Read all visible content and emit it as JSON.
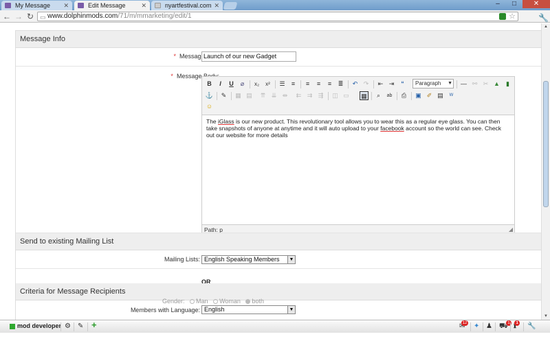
{
  "browser": {
    "tabs": [
      {
        "title": "My Message",
        "active": false
      },
      {
        "title": "Edit Message",
        "active": true
      },
      {
        "title": "nyartfestival.com",
        "active": false
      }
    ],
    "url_host": "www.dolphinmods.com",
    "url_path": "/71/m/mmarketing/edit/1",
    "window_buttons": {
      "minimize": "–",
      "maximize": "□",
      "close": "✕"
    }
  },
  "sections": {
    "message_info": "Message Info",
    "mailing_list": "Send to existing Mailing List",
    "criteria": "Criteria for Message Recipients"
  },
  "form": {
    "title_label": "Message Title:",
    "title_value": "Launch of our new Gadget",
    "body_label": "Message Body:",
    "required_mark": "*",
    "editor": {
      "format_value": "Paragraph",
      "body_parts": [
        "The ",
        "iGlass",
        " is our new product. This revolutionary tool allows you to wear this as a regular eye glass. You can then take snapshots of anyone at anytime and it will auto upload to your ",
        "facebook",
        " account so the world can see. Check out our website for more details"
      ],
      "path_label": "Path:",
      "path_value": "p"
    },
    "mailing_lists_label": "Mailing Lists:",
    "mailing_lists_value": "English Speaking Members",
    "or_text": "OR",
    "language_label": "Members with Language:",
    "language_value": "English",
    "gender_label": "Gender:",
    "gender_options": [
      "Man",
      "Woman",
      "both"
    ]
  },
  "bottom_bar": {
    "member_name": "mod developer",
    "mail_count": "12",
    "cart_count": "1",
    "notice_count": "1"
  },
  "colors": {
    "status_online": "#2fa82f",
    "badge": "#dd2222",
    "required": "#dd3333"
  }
}
